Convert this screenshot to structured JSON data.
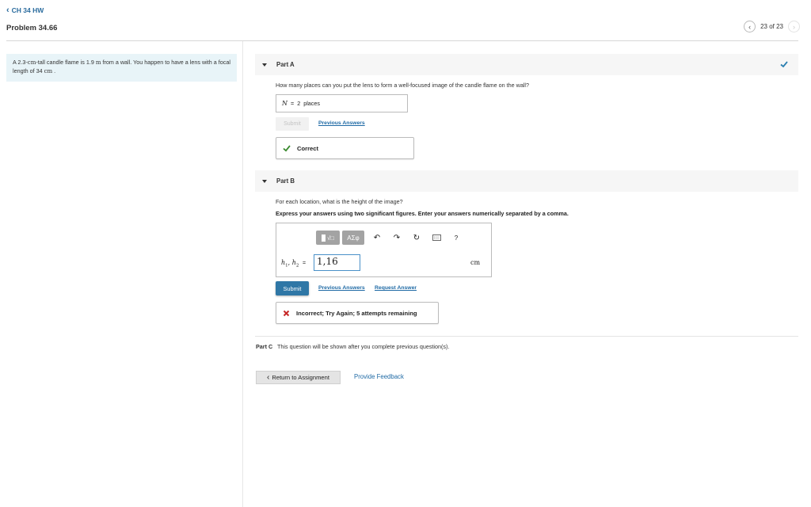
{
  "header": {
    "back_label": "CH 34 HW",
    "problem_title": "Problem 34.66",
    "pager_text": "23 of 23"
  },
  "problem": {
    "text_1": "A 2.3-",
    "unit_1": "cm",
    "text_2": "-tall candle flame is 1.9 ",
    "unit_2": "m",
    "text_3": " from a wall. You happen to have a lens with a focal length of 34 ",
    "unit_3": "cm",
    "text_4": " ."
  },
  "partA": {
    "title": "Part A",
    "question": "How many places can you put the lens to form a well-focused image of the candle flame on the wall?",
    "var_label": "N",
    "equals": "=",
    "answer_value": "2",
    "answer_unit": "places",
    "submit_label": "Submit",
    "prev_answers_label": "Previous Answers",
    "feedback": "Correct",
    "status_color": "#2b7fb0"
  },
  "partB": {
    "title": "Part B",
    "question": "For each location, what is the height of the image?",
    "instruction": "Express your answers using two significant figures. Enter your answers numerically separated by a comma.",
    "toolbar": {
      "template_label": "√□",
      "greek_label": "ΑΣφ",
      "help_label": "?"
    },
    "var_h": "h",
    "sub_1": "1",
    "sep": ", ",
    "sub_2": "2",
    "equals": "=",
    "input_value": "1,16",
    "unit": "cm",
    "submit_label": "Submit",
    "prev_answers_label": "Previous Answers",
    "request_answer_label": "Request Answer",
    "feedback": "Incorrect; Try Again; 5 attempts remaining",
    "error_color": "#c62828"
  },
  "partC": {
    "label": "Part C",
    "text": "This question will be shown after you complete previous question(s)."
  },
  "footer": {
    "return_label": "Return to Assignment",
    "feedback_label": "Provide Feedback"
  }
}
